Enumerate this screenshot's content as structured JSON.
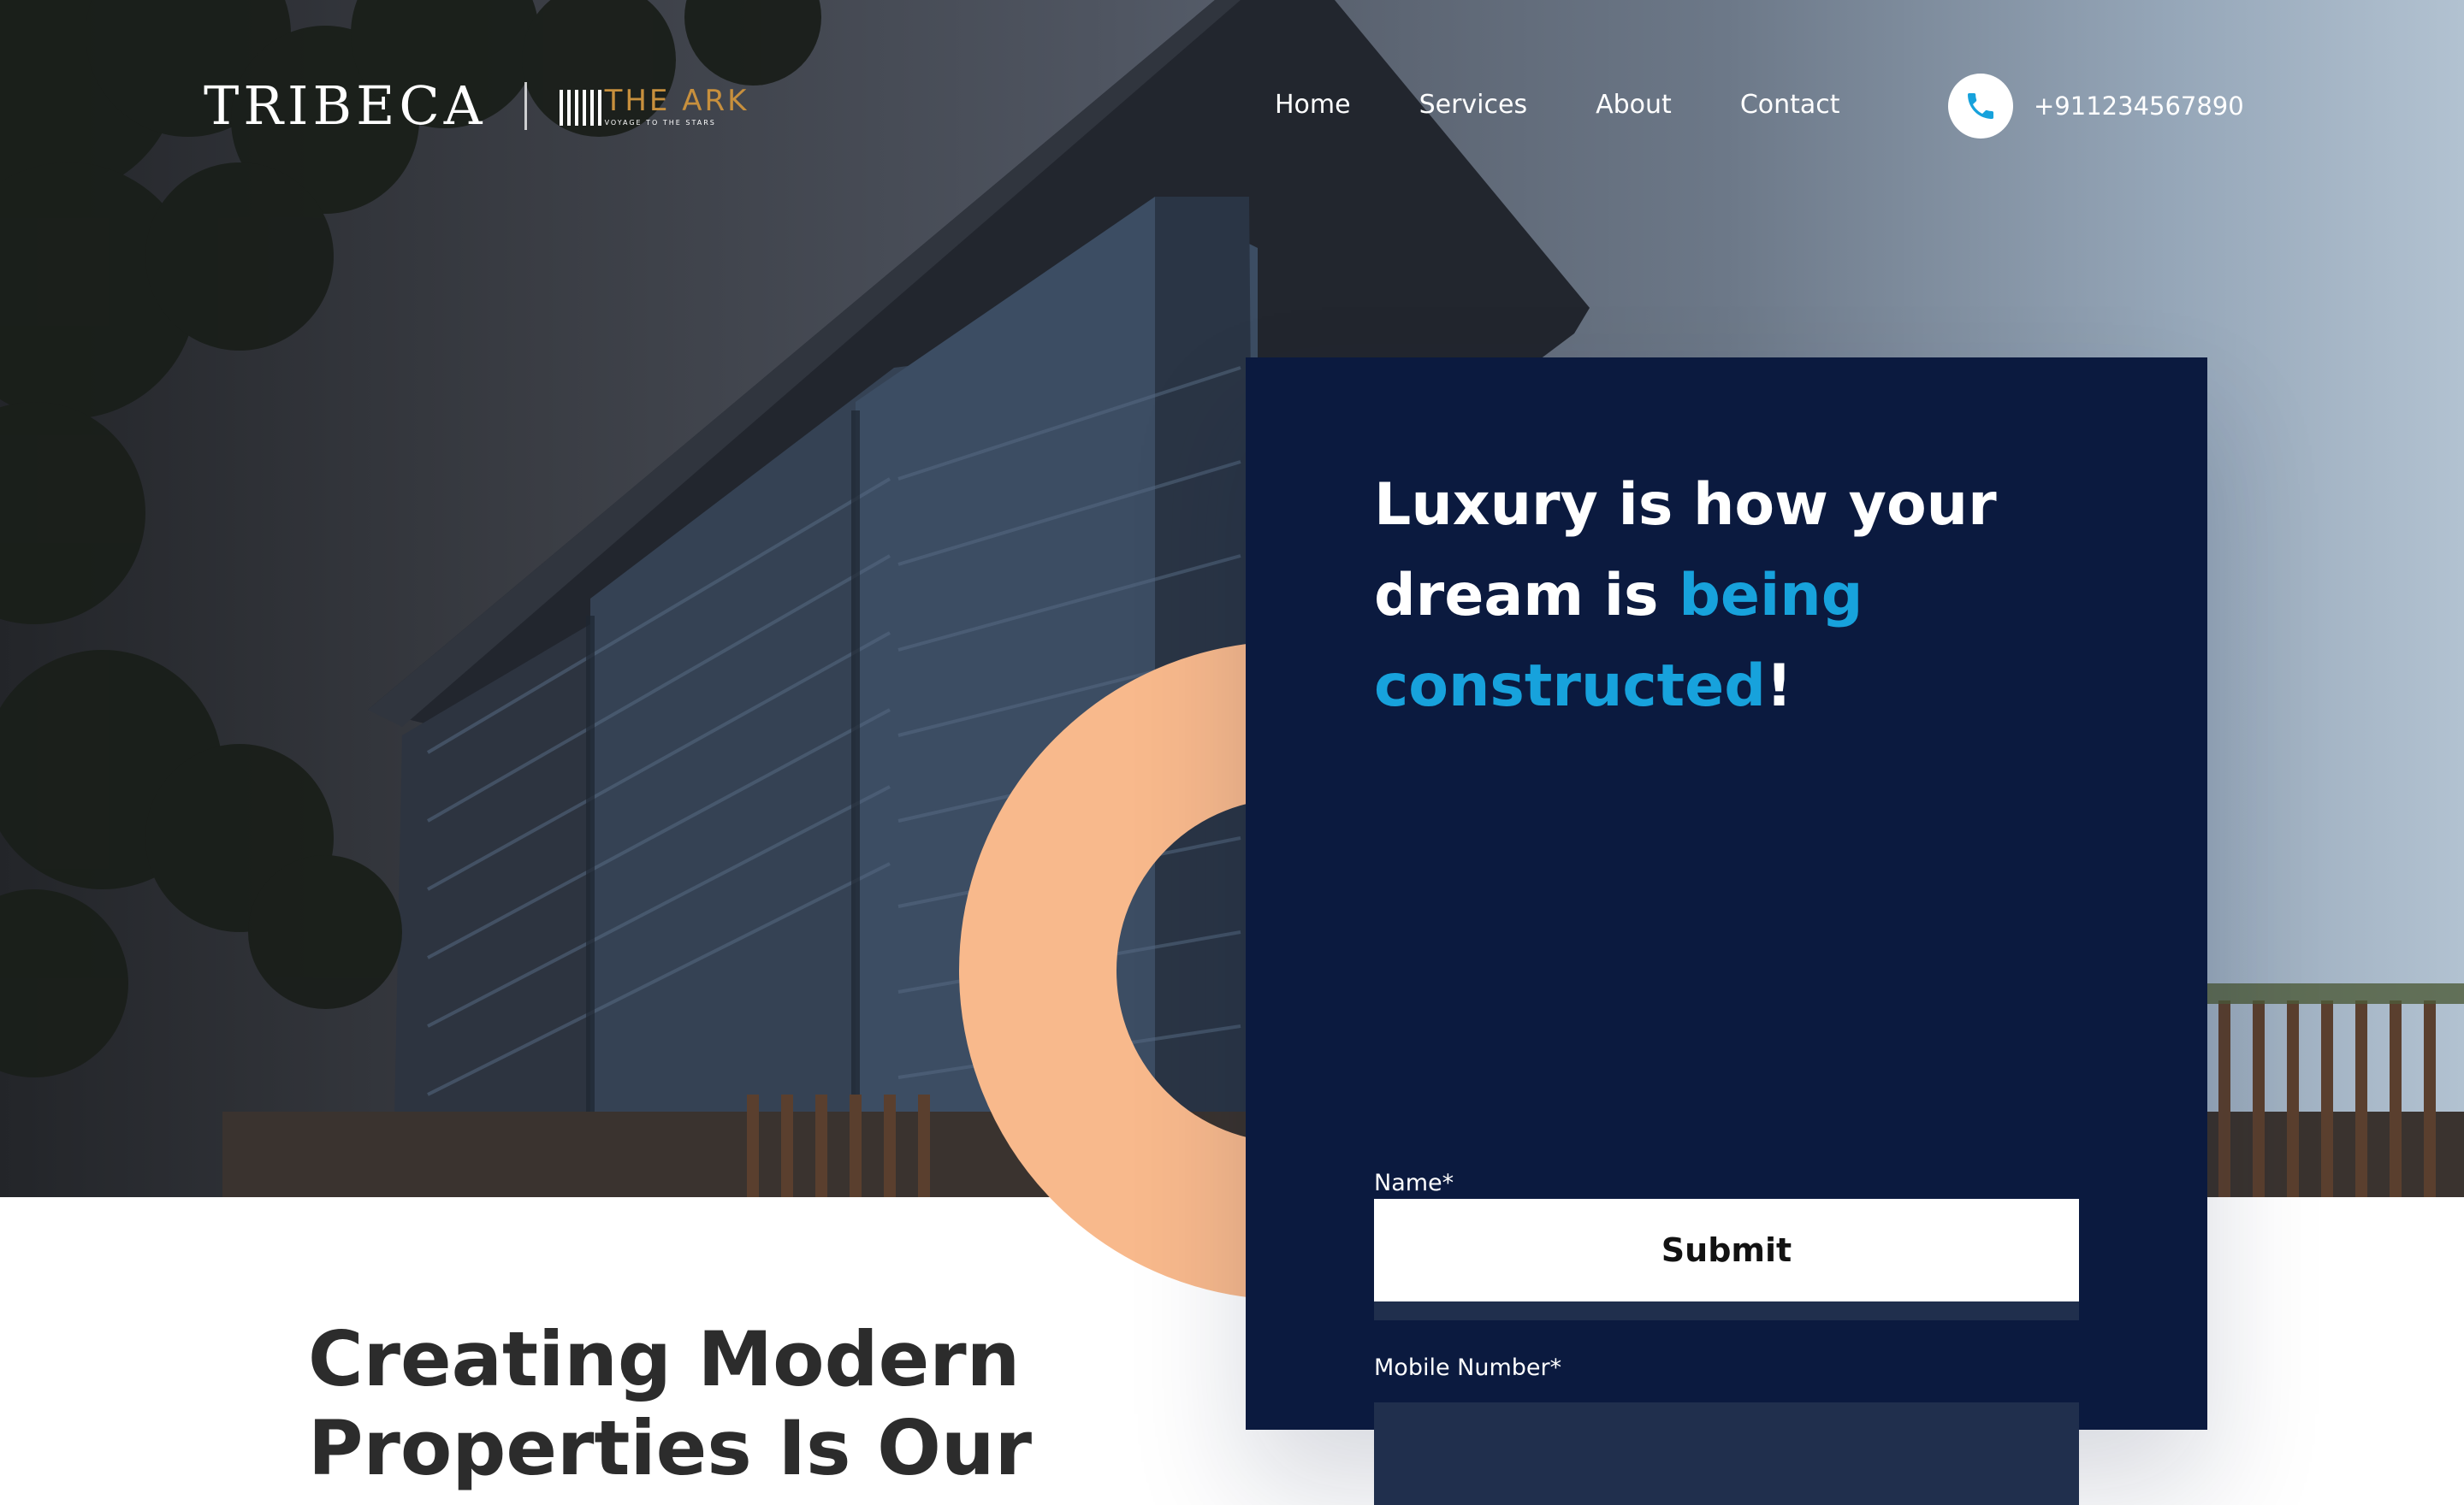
{
  "header": {
    "brand": "TRIBECA",
    "partner_brand": "THE ARK",
    "partner_tagline": "VOYAGE TO THE STARS",
    "nav": [
      {
        "label": "Home"
      },
      {
        "label": "Services"
      },
      {
        "label": "About"
      },
      {
        "label": "Contact"
      }
    ],
    "phone": {
      "number": "+911234567890",
      "icon": "phone-icon"
    }
  },
  "form_card": {
    "title_part1": "Luxury is how your dream is ",
    "title_accent": "being constructed",
    "title_end": "!",
    "name_label": "Name*",
    "name_value": "",
    "mobile_label": "Mobile Number*",
    "mobile_value": "",
    "submit_label": "Submit"
  },
  "section": {
    "headline_line1": "Creating Modern",
    "headline_line2": "Properties Is Our"
  },
  "colors": {
    "card_bg": "#0b1a3f",
    "input_bg": "#202f4d",
    "accent": "#17a2dc",
    "peach": "#f8b98c",
    "headline_text": "#2c2c2c"
  }
}
